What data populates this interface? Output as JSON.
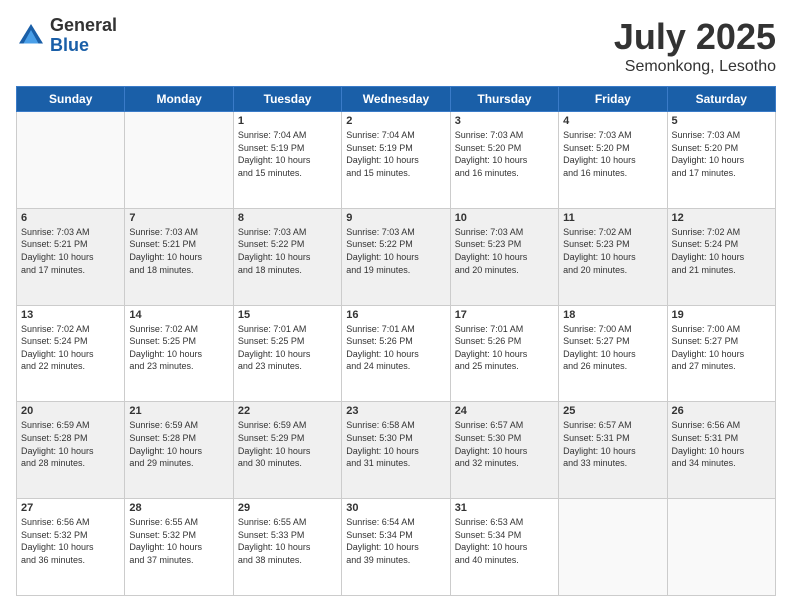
{
  "header": {
    "logo_general": "General",
    "logo_blue": "Blue",
    "month_title": "July 2025",
    "location": "Semonkong, Lesotho"
  },
  "weekdays": [
    "Sunday",
    "Monday",
    "Tuesday",
    "Wednesday",
    "Thursday",
    "Friday",
    "Saturday"
  ],
  "weeks": [
    {
      "shaded": false,
      "days": [
        {
          "num": "",
          "info": ""
        },
        {
          "num": "",
          "info": ""
        },
        {
          "num": "1",
          "info": "Sunrise: 7:04 AM\nSunset: 5:19 PM\nDaylight: 10 hours\nand 15 minutes."
        },
        {
          "num": "2",
          "info": "Sunrise: 7:04 AM\nSunset: 5:19 PM\nDaylight: 10 hours\nand 15 minutes."
        },
        {
          "num": "3",
          "info": "Sunrise: 7:03 AM\nSunset: 5:20 PM\nDaylight: 10 hours\nand 16 minutes."
        },
        {
          "num": "4",
          "info": "Sunrise: 7:03 AM\nSunset: 5:20 PM\nDaylight: 10 hours\nand 16 minutes."
        },
        {
          "num": "5",
          "info": "Sunrise: 7:03 AM\nSunset: 5:20 PM\nDaylight: 10 hours\nand 17 minutes."
        }
      ]
    },
    {
      "shaded": true,
      "days": [
        {
          "num": "6",
          "info": "Sunrise: 7:03 AM\nSunset: 5:21 PM\nDaylight: 10 hours\nand 17 minutes."
        },
        {
          "num": "7",
          "info": "Sunrise: 7:03 AM\nSunset: 5:21 PM\nDaylight: 10 hours\nand 18 minutes."
        },
        {
          "num": "8",
          "info": "Sunrise: 7:03 AM\nSunset: 5:22 PM\nDaylight: 10 hours\nand 18 minutes."
        },
        {
          "num": "9",
          "info": "Sunrise: 7:03 AM\nSunset: 5:22 PM\nDaylight: 10 hours\nand 19 minutes."
        },
        {
          "num": "10",
          "info": "Sunrise: 7:03 AM\nSunset: 5:23 PM\nDaylight: 10 hours\nand 20 minutes."
        },
        {
          "num": "11",
          "info": "Sunrise: 7:02 AM\nSunset: 5:23 PM\nDaylight: 10 hours\nand 20 minutes."
        },
        {
          "num": "12",
          "info": "Sunrise: 7:02 AM\nSunset: 5:24 PM\nDaylight: 10 hours\nand 21 minutes."
        }
      ]
    },
    {
      "shaded": false,
      "days": [
        {
          "num": "13",
          "info": "Sunrise: 7:02 AM\nSunset: 5:24 PM\nDaylight: 10 hours\nand 22 minutes."
        },
        {
          "num": "14",
          "info": "Sunrise: 7:02 AM\nSunset: 5:25 PM\nDaylight: 10 hours\nand 23 minutes."
        },
        {
          "num": "15",
          "info": "Sunrise: 7:01 AM\nSunset: 5:25 PM\nDaylight: 10 hours\nand 23 minutes."
        },
        {
          "num": "16",
          "info": "Sunrise: 7:01 AM\nSunset: 5:26 PM\nDaylight: 10 hours\nand 24 minutes."
        },
        {
          "num": "17",
          "info": "Sunrise: 7:01 AM\nSunset: 5:26 PM\nDaylight: 10 hours\nand 25 minutes."
        },
        {
          "num": "18",
          "info": "Sunrise: 7:00 AM\nSunset: 5:27 PM\nDaylight: 10 hours\nand 26 minutes."
        },
        {
          "num": "19",
          "info": "Sunrise: 7:00 AM\nSunset: 5:27 PM\nDaylight: 10 hours\nand 27 minutes."
        }
      ]
    },
    {
      "shaded": true,
      "days": [
        {
          "num": "20",
          "info": "Sunrise: 6:59 AM\nSunset: 5:28 PM\nDaylight: 10 hours\nand 28 minutes."
        },
        {
          "num": "21",
          "info": "Sunrise: 6:59 AM\nSunset: 5:28 PM\nDaylight: 10 hours\nand 29 minutes."
        },
        {
          "num": "22",
          "info": "Sunrise: 6:59 AM\nSunset: 5:29 PM\nDaylight: 10 hours\nand 30 minutes."
        },
        {
          "num": "23",
          "info": "Sunrise: 6:58 AM\nSunset: 5:30 PM\nDaylight: 10 hours\nand 31 minutes."
        },
        {
          "num": "24",
          "info": "Sunrise: 6:57 AM\nSunset: 5:30 PM\nDaylight: 10 hours\nand 32 minutes."
        },
        {
          "num": "25",
          "info": "Sunrise: 6:57 AM\nSunset: 5:31 PM\nDaylight: 10 hours\nand 33 minutes."
        },
        {
          "num": "26",
          "info": "Sunrise: 6:56 AM\nSunset: 5:31 PM\nDaylight: 10 hours\nand 34 minutes."
        }
      ]
    },
    {
      "shaded": false,
      "days": [
        {
          "num": "27",
          "info": "Sunrise: 6:56 AM\nSunset: 5:32 PM\nDaylight: 10 hours\nand 36 minutes."
        },
        {
          "num": "28",
          "info": "Sunrise: 6:55 AM\nSunset: 5:32 PM\nDaylight: 10 hours\nand 37 minutes."
        },
        {
          "num": "29",
          "info": "Sunrise: 6:55 AM\nSunset: 5:33 PM\nDaylight: 10 hours\nand 38 minutes."
        },
        {
          "num": "30",
          "info": "Sunrise: 6:54 AM\nSunset: 5:34 PM\nDaylight: 10 hours\nand 39 minutes."
        },
        {
          "num": "31",
          "info": "Sunrise: 6:53 AM\nSunset: 5:34 PM\nDaylight: 10 hours\nand 40 minutes."
        },
        {
          "num": "",
          "info": ""
        },
        {
          "num": "",
          "info": ""
        }
      ]
    }
  ]
}
